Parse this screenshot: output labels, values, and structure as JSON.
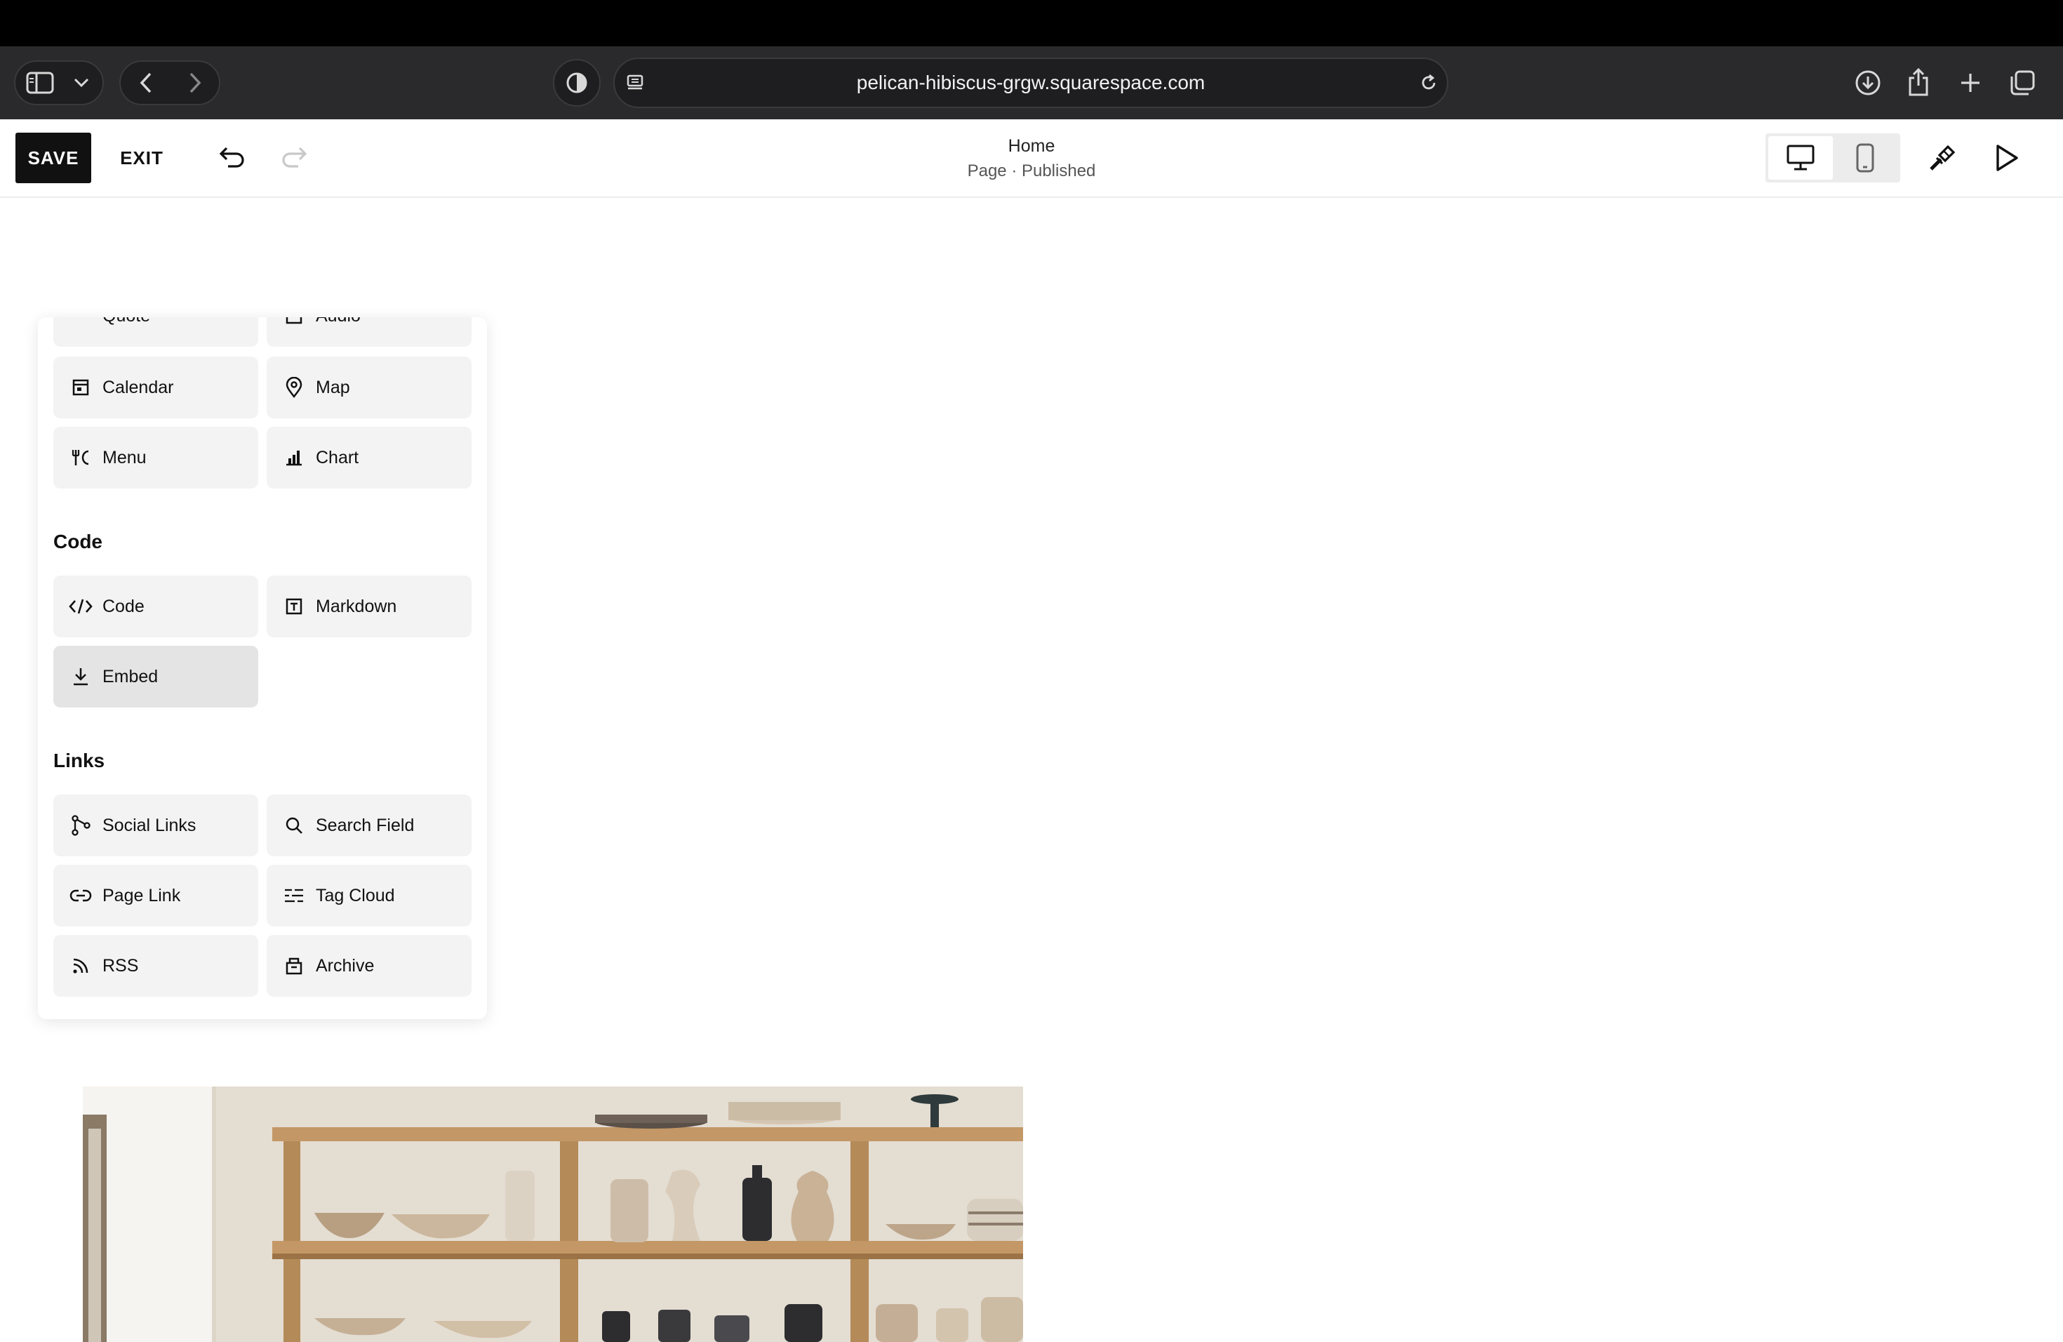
{
  "browser": {
    "url": "pelican-hibiscus-grgw.squarespace.com"
  },
  "editor": {
    "save_label": "SAVE",
    "exit_label": "EXIT",
    "page_title": "Home",
    "page_status": "Page · Published"
  },
  "panel": {
    "partial_row": [
      "Quote",
      "Audio"
    ],
    "row_calendar": [
      "Calendar",
      "Map"
    ],
    "row_menu": [
      "Menu",
      "Chart"
    ],
    "code_heading": "Code",
    "code_items": [
      "Code",
      "Markdown",
      "Embed"
    ],
    "links_heading": "Links",
    "links_items": [
      "Social Links",
      "Search Field",
      "Page Link",
      "Tag Cloud",
      "RSS",
      "Archive"
    ]
  },
  "icons": {
    "sidebar": "sidebar-icon",
    "back": "chevron-left-icon",
    "forward": "chevron-right-icon",
    "reload": "reload-icon",
    "download": "download-icon",
    "share": "share-icon",
    "new_tab": "plus-icon",
    "tabs": "tabs-icon",
    "undo": "undo-icon",
    "redo": "redo-icon",
    "desktop": "desktop-icon",
    "mobile": "mobile-icon",
    "design": "paintbrush-icon",
    "preview": "play-icon"
  },
  "colors": {
    "accent": "#111111",
    "tile_bg": "#f3f3f3",
    "tile_selected": "#e4e4e4"
  }
}
